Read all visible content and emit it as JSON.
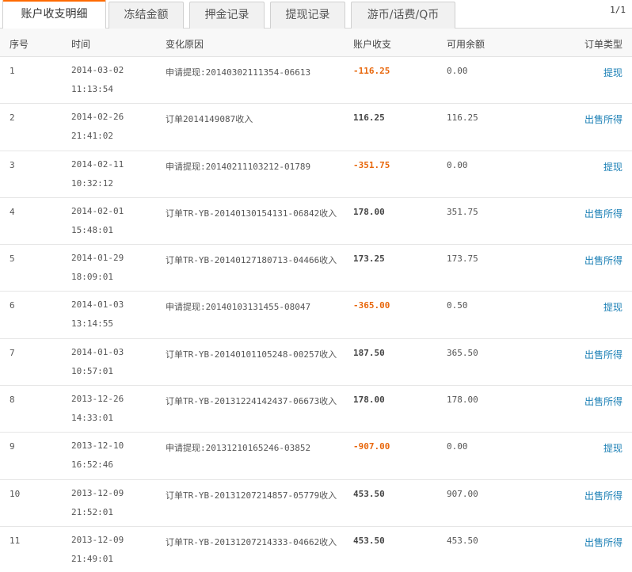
{
  "tabs": [
    {
      "label": "账户收支明细",
      "active": true
    },
    {
      "label": "冻结金额",
      "active": false
    },
    {
      "label": "押金记录",
      "active": false
    },
    {
      "label": "提现记录",
      "active": false
    },
    {
      "label": "游币/话费/Q币",
      "active": false
    }
  ],
  "pager": "1/1",
  "columns": {
    "idx": "序号",
    "time": "时间",
    "reason": "变化原因",
    "amount": "账户收支",
    "balance": "可用余额",
    "type": "订单类型"
  },
  "rows": [
    {
      "idx": "1",
      "date": "2014-03-02",
      "clock": "11:13:54",
      "reason": "申请提现:20140302111354-06613",
      "amount": "-116.25",
      "negative": true,
      "balance": "0.00",
      "type": "提现"
    },
    {
      "idx": "2",
      "date": "2014-02-26",
      "clock": "21:41:02",
      "reason": "订单2014149087收入",
      "amount": "116.25",
      "negative": false,
      "balance": "116.25",
      "type": "出售所得"
    },
    {
      "idx": "3",
      "date": "2014-02-11",
      "clock": "10:32:12",
      "reason": "申请提现:20140211103212-01789",
      "amount": "-351.75",
      "negative": true,
      "balance": "0.00",
      "type": "提现"
    },
    {
      "idx": "4",
      "date": "2014-02-01",
      "clock": "15:48:01",
      "reason": "订单TR-YB-20140130154131-06842收入",
      "amount": "178.00",
      "negative": false,
      "balance": "351.75",
      "type": "出售所得"
    },
    {
      "idx": "5",
      "date": "2014-01-29",
      "clock": "18:09:01",
      "reason": "订单TR-YB-20140127180713-04466收入",
      "amount": "173.25",
      "negative": false,
      "balance": "173.75",
      "type": "出售所得"
    },
    {
      "idx": "6",
      "date": "2014-01-03",
      "clock": "13:14:55",
      "reason": "申请提现:20140103131455-08047",
      "amount": "-365.00",
      "negative": true,
      "balance": "0.50",
      "type": "提现"
    },
    {
      "idx": "7",
      "date": "2014-01-03",
      "clock": "10:57:01",
      "reason": "订单TR-YB-20140101105248-00257收入",
      "amount": "187.50",
      "negative": false,
      "balance": "365.50",
      "type": "出售所得"
    },
    {
      "idx": "8",
      "date": "2013-12-26",
      "clock": "14:33:01",
      "reason": "订单TR-YB-20131224142437-06673收入",
      "amount": "178.00",
      "negative": false,
      "balance": "178.00",
      "type": "出售所得"
    },
    {
      "idx": "9",
      "date": "2013-12-10",
      "clock": "16:52:46",
      "reason": "申请提现:20131210165246-03852",
      "amount": "-907.00",
      "negative": true,
      "balance": "0.00",
      "type": "提现"
    },
    {
      "idx": "10",
      "date": "2013-12-09",
      "clock": "21:52:01",
      "reason": "订单TR-YB-20131207214857-05779收入",
      "amount": "453.50",
      "negative": false,
      "balance": "907.00",
      "type": "出售所得"
    },
    {
      "idx": "11",
      "date": "2013-12-09",
      "clock": "21:49:01",
      "reason": "订单TR-YB-20131207214333-04662收入",
      "amount": "453.50",
      "negative": false,
      "balance": "453.50",
      "type": "出售所得"
    }
  ],
  "colors": {
    "accent": "#ff6a00",
    "negative": "#e8670c",
    "link": "#1a7fb5"
  }
}
